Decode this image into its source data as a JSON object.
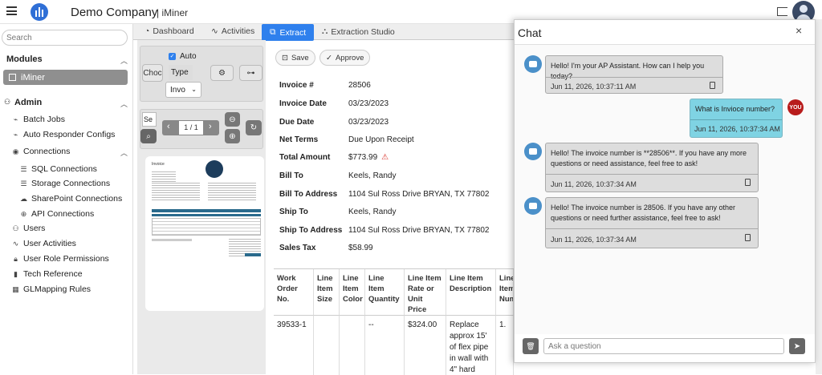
{
  "header": {
    "company": "Demo Company",
    "app": "| iMiner"
  },
  "sidebar": {
    "search_placeholder": "Search",
    "modules_label": "Modules",
    "selected_module": "iMiner",
    "admin_label": "Admin",
    "items": [
      {
        "label": "Batch Jobs"
      },
      {
        "label": "Auto Responder Configs"
      },
      {
        "label": "Connections"
      },
      {
        "label": "SQL Connections"
      },
      {
        "label": "Storage Connections"
      },
      {
        "label": "SharePoint Connections"
      },
      {
        "label": "API Connections"
      },
      {
        "label": "Users"
      },
      {
        "label": "User Activities"
      },
      {
        "label": "User Role Permissions"
      },
      {
        "label": "Tech Reference"
      },
      {
        "label": "GLMapping Rules"
      }
    ]
  },
  "tabs": [
    "Dashboard",
    "Activities",
    "Extract",
    "Extraction Studio"
  ],
  "doc": {
    "choose_label": "Choc",
    "auto_label": "Auto",
    "type_label": "Type",
    "type_value": "Invo",
    "page_search": "Se",
    "page_indicator": "1 / 1",
    "thumb_title": "Invoice"
  },
  "actions": {
    "save": "Save",
    "approve": "Approve"
  },
  "fields": [
    {
      "label": "Invoice #",
      "value": "28506"
    },
    {
      "label": "Invoice Date",
      "value": "03/23/2023"
    },
    {
      "label": "Due Date",
      "value": "03/23/2023"
    },
    {
      "label": "Net Terms",
      "value": "Due Upon Receipt"
    },
    {
      "label": "Total Amount",
      "value": "$773.99"
    },
    {
      "label": "Bill To",
      "value": "Keels, Randy"
    },
    {
      "label": "Bill To Address",
      "value": "1104 Sul Ross Drive BRYAN, TX 77802"
    },
    {
      "label": "Ship To",
      "value": "Keels, Randy"
    },
    {
      "label": "Ship To Address",
      "value": "1104 Sul Ross Drive BRYAN, TX 77802"
    },
    {
      "label": "Sales Tax",
      "value": "$58.99"
    }
  ],
  "table": {
    "headers": [
      "Work Order No.",
      "Line Item Size",
      "Line Item Color",
      "Line Item Quantity",
      "Line Item Rate or Unit Price",
      "Line Item Description",
      "Line Item Num"
    ],
    "row": [
      "39533-1",
      "",
      "",
      "--",
      "$324.00",
      "Replace approx 15' of flex pipe in wall with 4\" hard",
      "1."
    ]
  },
  "chat": {
    "title": "Chat",
    "close": "×",
    "messages": [
      {
        "from": "bot",
        "text": "Hello! I'm your AP Assistant. How can I help you today?",
        "time": "Jun 11, 2026, 10:37:11 AM"
      },
      {
        "from": "user",
        "text": "What is Invioce number?",
        "time": "Jun 11, 2026, 10:37:34 AM"
      },
      {
        "from": "bot",
        "text": "Hello! The invoice number is **28506**. If you have any more questions or need assistance, feel free to ask!",
        "time": "Jun 11, 2026, 10:37:34 AM"
      },
      {
        "from": "bot",
        "text": "Hello! The invoice number is 28506. If you have any other questions or need further assistance, feel free to ask!",
        "time": "Jun 11, 2026, 10:37:34 AM"
      }
    ],
    "user_avatar": "YOU",
    "input_placeholder": "Ask a question"
  },
  "colors": {
    "accent": "#2f80ed",
    "user_bubble": "#7fd3e3",
    "bot_bubble": "#dddddd",
    "warning": "#d9342b"
  }
}
